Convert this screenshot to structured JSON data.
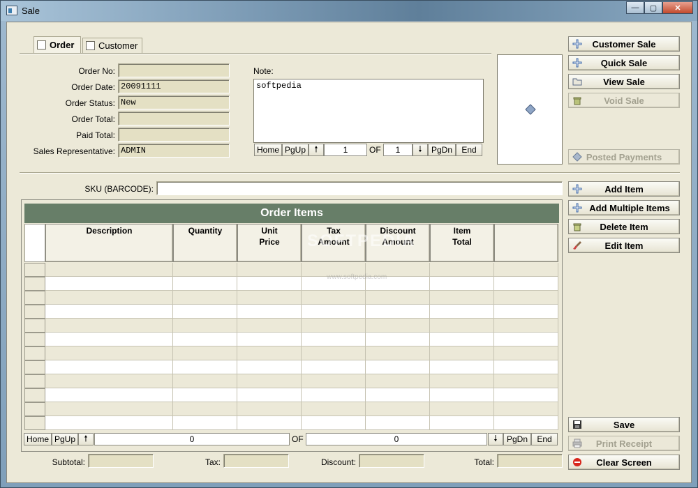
{
  "window": {
    "title": "Sale",
    "controls": {
      "minimize": "—",
      "maximize": "▢",
      "close": "✕"
    }
  },
  "tabs": [
    {
      "label": "Order",
      "active": true
    },
    {
      "label": "Customer",
      "active": false
    }
  ],
  "form": {
    "order_no_label": "Order No:",
    "order_no": "",
    "order_date_label": "Order Date:",
    "order_date": "20091111",
    "order_status_label": "Order Status:",
    "order_status": "New",
    "order_total_label": "Order Total:",
    "order_total": "",
    "paid_total_label": "Paid Total:",
    "paid_total": "",
    "sales_rep_label": "Sales Representative:",
    "sales_rep": "ADMIN"
  },
  "note": {
    "label": "Note:",
    "value": "softpedia",
    "nav": {
      "home": "Home",
      "pgup": "PgUp",
      "up": "🠕",
      "current": "1",
      "of": "OF",
      "total": "1",
      "down": "🠗",
      "pgdn": "PgDn",
      "end": "End"
    }
  },
  "side_buttons": {
    "customer_sale": "Customer Sale",
    "quick_sale": "Quick Sale",
    "view_sale": "View Sale",
    "void_sale": "Void Sale",
    "posted_payments": "Posted Payments",
    "add_item": "Add Item",
    "add_multiple_items": "Add Multiple Items",
    "delete_item": "Delete Item",
    "edit_item": "Edit Item",
    "save": "Save",
    "print_receipt": "Print Receipt",
    "clear_screen": "Clear Screen"
  },
  "sku": {
    "label": "SKU (BARCODE):",
    "value": ""
  },
  "grid": {
    "title": "Order Items",
    "columns": [
      "Description",
      "Quantity",
      "Unit\nPrice",
      "Tax\nAmount",
      "Discount\nAmount",
      "Item\nTotal",
      ""
    ],
    "row_count": 12,
    "nav": {
      "home": "Home",
      "pgup": "PgUp",
      "up": "🠕",
      "current": "0",
      "of": "OF",
      "total": "0",
      "down": "🠗",
      "pgdn": "PgDn",
      "end": "End"
    }
  },
  "watermark": {
    "main": "SOFTPEDIA",
    "sub": "www.softpedia.com"
  },
  "totals": {
    "subtotal_label": "Subtotal:",
    "subtotal": "",
    "tax_label": "Tax:",
    "tax": "",
    "discount_label": "Discount:",
    "discount": "",
    "total_label": "Total:",
    "total": ""
  },
  "colors": {
    "grid_header": "#677e68",
    "client_bg": "#ece9d8",
    "field_bg": "#e4e0c4"
  }
}
